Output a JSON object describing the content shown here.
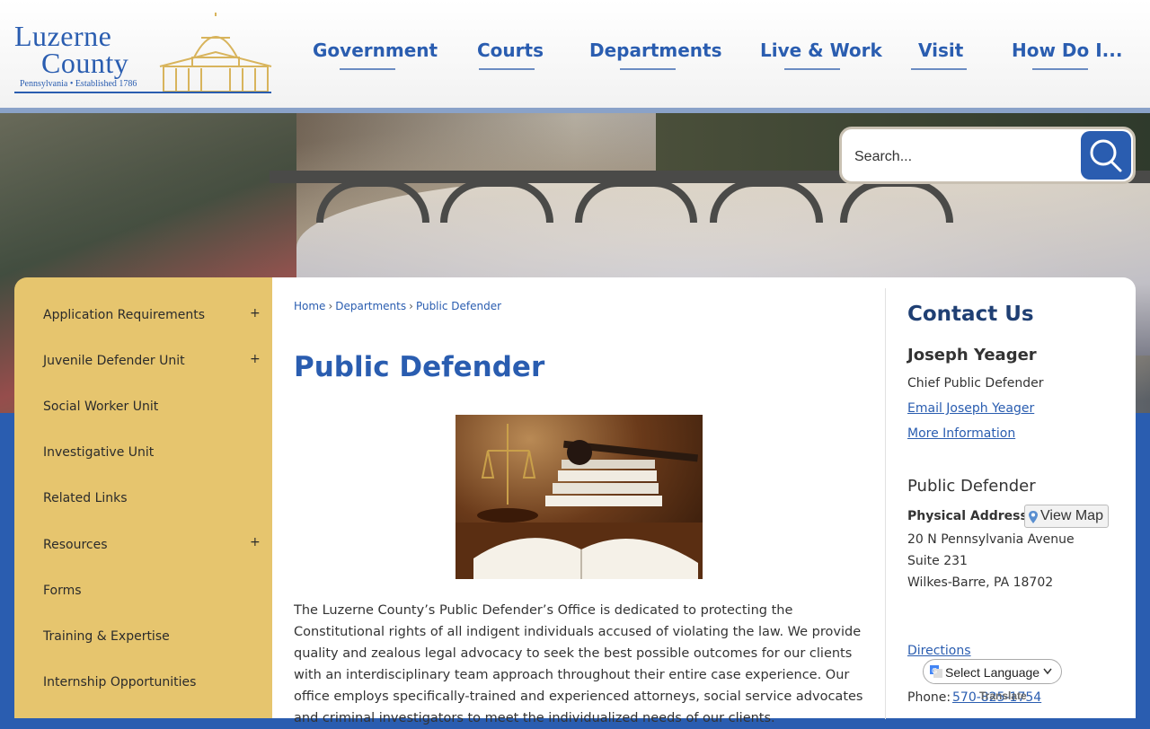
{
  "logo": {
    "line1": "Luzerne",
    "line2": "County",
    "tagline": "Pennsylvania • Established 1786"
  },
  "nav": {
    "items": [
      {
        "label": "Government"
      },
      {
        "label": "Courts"
      },
      {
        "label": "Departments"
      },
      {
        "label": "Live & Work"
      },
      {
        "label": "Visit"
      },
      {
        "label": "How Do I..."
      }
    ]
  },
  "search": {
    "placeholder": "Search..."
  },
  "sidebar": {
    "items": [
      {
        "label": "Application Requirements",
        "expand": "+"
      },
      {
        "label": "Juvenile Defender Unit",
        "expand": "+"
      },
      {
        "label": "Social Worker Unit",
        "expand": ""
      },
      {
        "label": "Investigative Unit",
        "expand": ""
      },
      {
        "label": "Related Links",
        "expand": ""
      },
      {
        "label": "Resources",
        "expand": "+"
      },
      {
        "label": "Forms",
        "expand": ""
      },
      {
        "label": "Training & Expertise",
        "expand": ""
      },
      {
        "label": "Internship Opportunities",
        "expand": ""
      }
    ]
  },
  "breadcrumb": {
    "items": [
      "Home",
      "Departments",
      "Public Defender"
    ],
    "separator": "›"
  },
  "main": {
    "title": "Public Defender",
    "intro": "The Luzerne County’s Public Defender’s Office is dedicated to protecting the Constitutional rights of all indigent individuals accused of violating the law. We provide quality and zealous legal advocacy to seek the best possible outcomes for our clients with an interdisciplinary team approach throughout their entire case experience. Our office employs specifically-trained and experienced attorneys, social service advocates and criminal investigators to meet the individualized needs of our clients."
  },
  "contact": {
    "heading": "Contact Us",
    "person_name": "Joseph Yeager",
    "person_title": "Chief Public Defender",
    "email_link": "Email Joseph Yeager",
    "more_info": "More Information",
    "office_name": "Public Defender",
    "address_label": "Physical Address",
    "view_map": "View Map",
    "address_line1": "20 N Pennsylvania Avenue",
    "address_line2": "Suite 231",
    "address_line3": "Wilkes-Barre, PA 18702",
    "directions": "Directions",
    "phone_label": "Phone:",
    "phone": "570-825-1754"
  },
  "translate": {
    "label": "Select Language",
    "powered": "Translate"
  },
  "colors": {
    "brand_blue": "#2a5db0",
    "sidebar_gold": "#e6c56e",
    "heading_navy": "#1f3f73"
  }
}
